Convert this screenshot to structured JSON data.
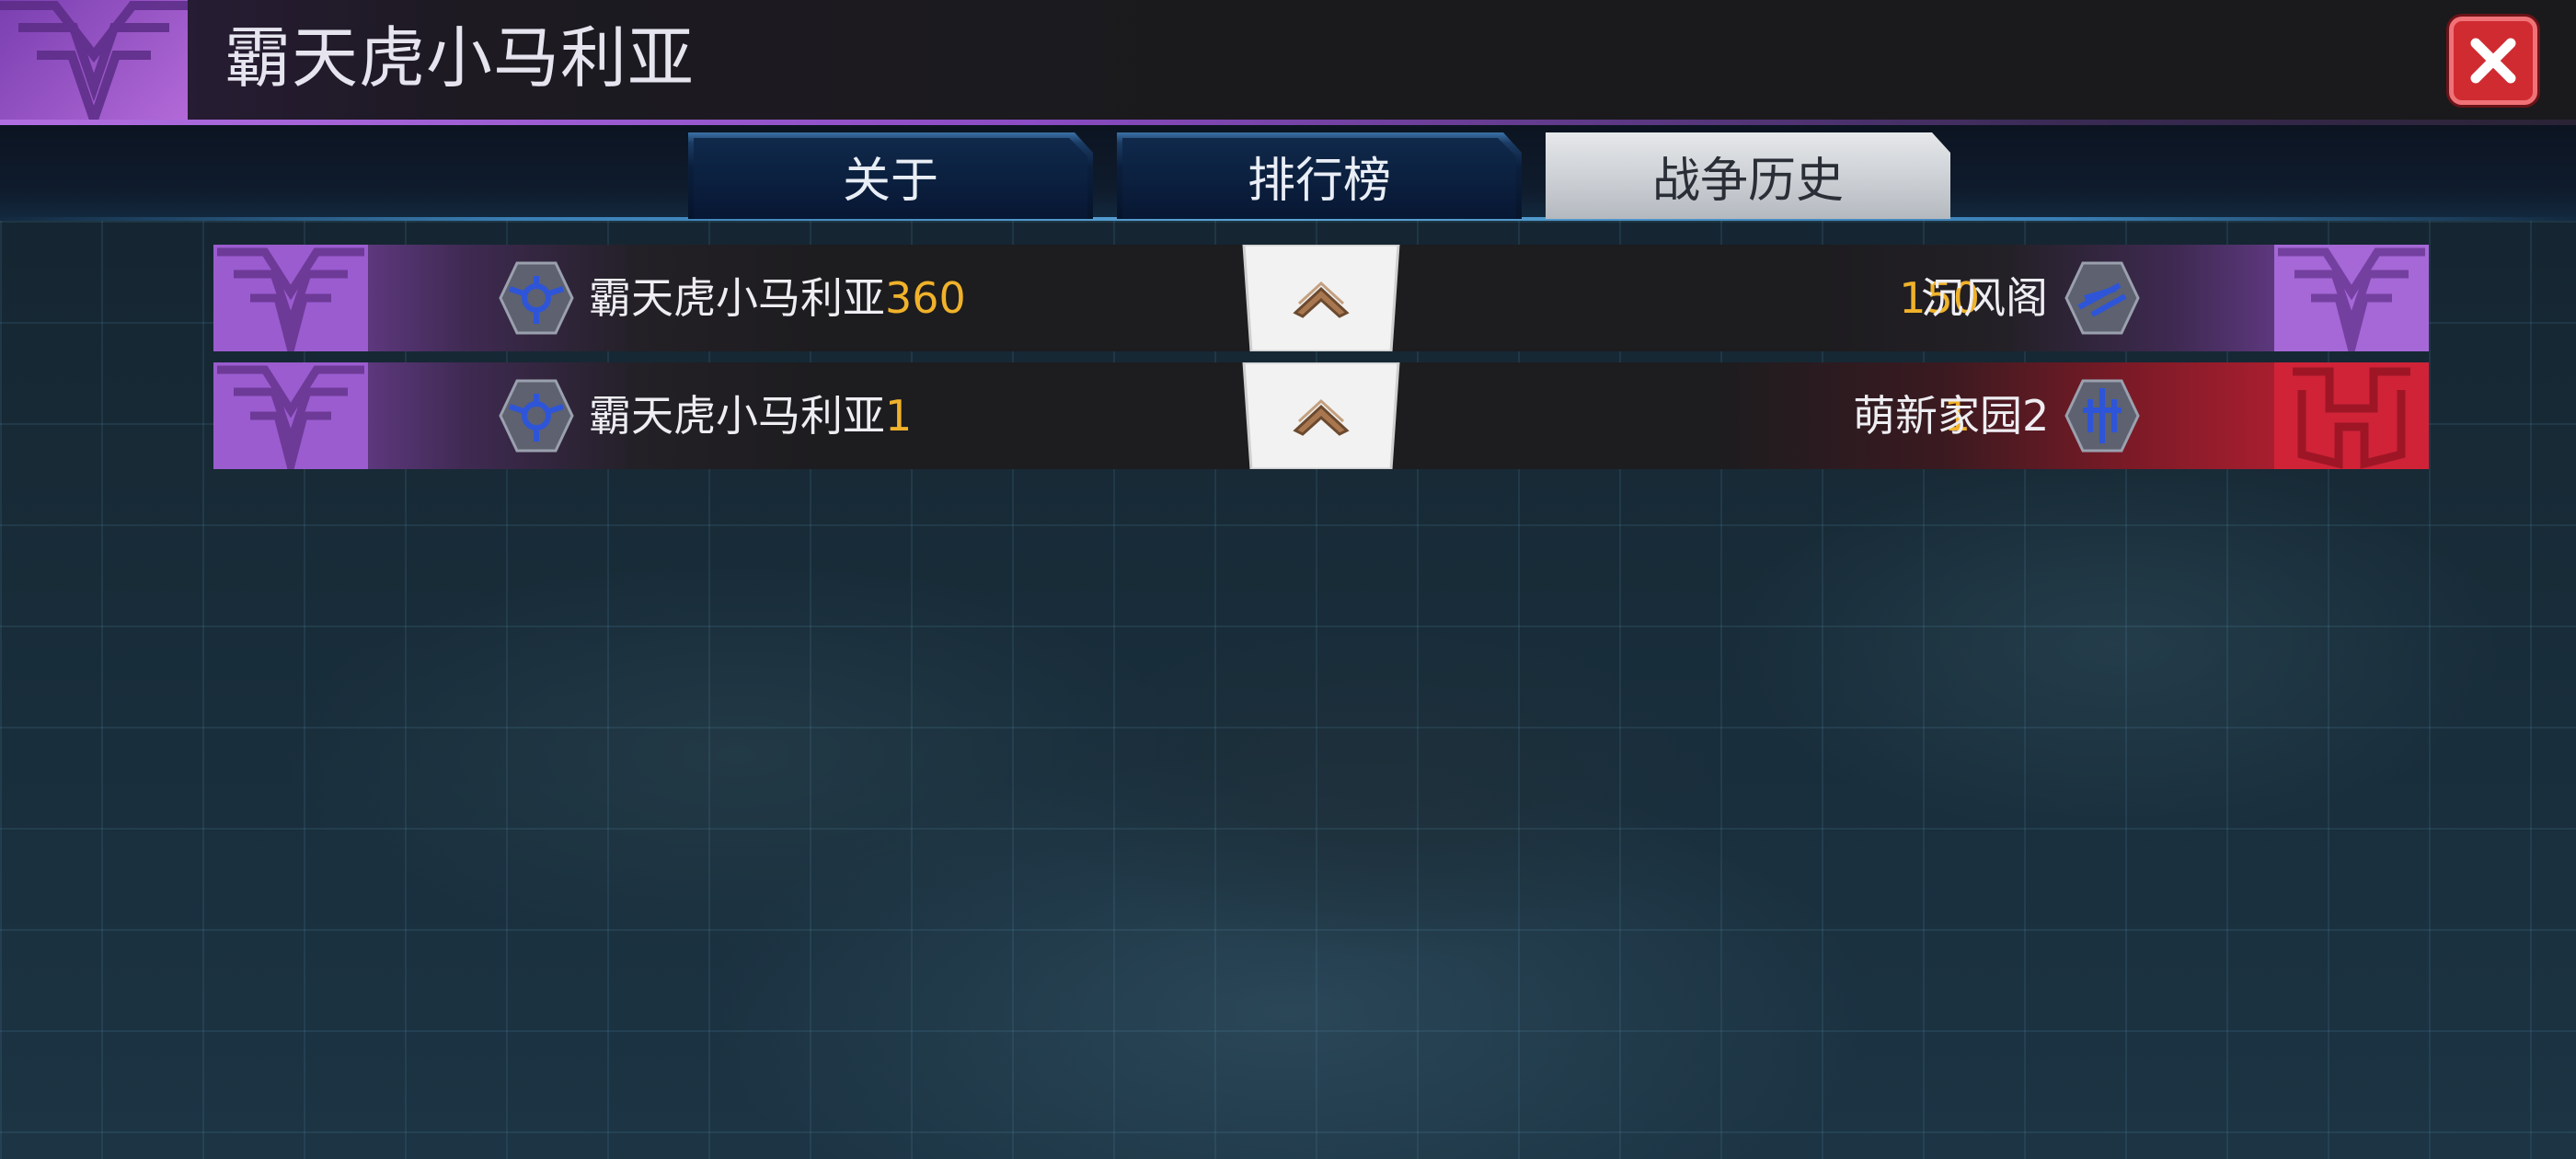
{
  "header": {
    "title": "霸天虎小马利亚",
    "close_icon": "close-icon"
  },
  "tabs": [
    {
      "label": "关于",
      "active": false
    },
    {
      "label": "排行榜",
      "active": false
    },
    {
      "label": "战争历史",
      "active": true
    }
  ],
  "war_history": [
    {
      "left_name": "霸天虎小马利亚",
      "left_score": "360",
      "left_faction": "decepticon",
      "right_score": "150",
      "right_name": "沉风阁",
      "right_faction": "decepticon"
    },
    {
      "left_name": "霸天虎小马利亚",
      "left_score": "1",
      "left_faction": "decepticon",
      "right_score": "1",
      "right_name": "萌新家园2",
      "right_faction": "autobot"
    }
  ],
  "colors": {
    "decepticon_purple": "#9a5ccf",
    "autobot_red": "#d02338",
    "score_gold": "#f0b22a",
    "close_red": "#cf2b31"
  }
}
